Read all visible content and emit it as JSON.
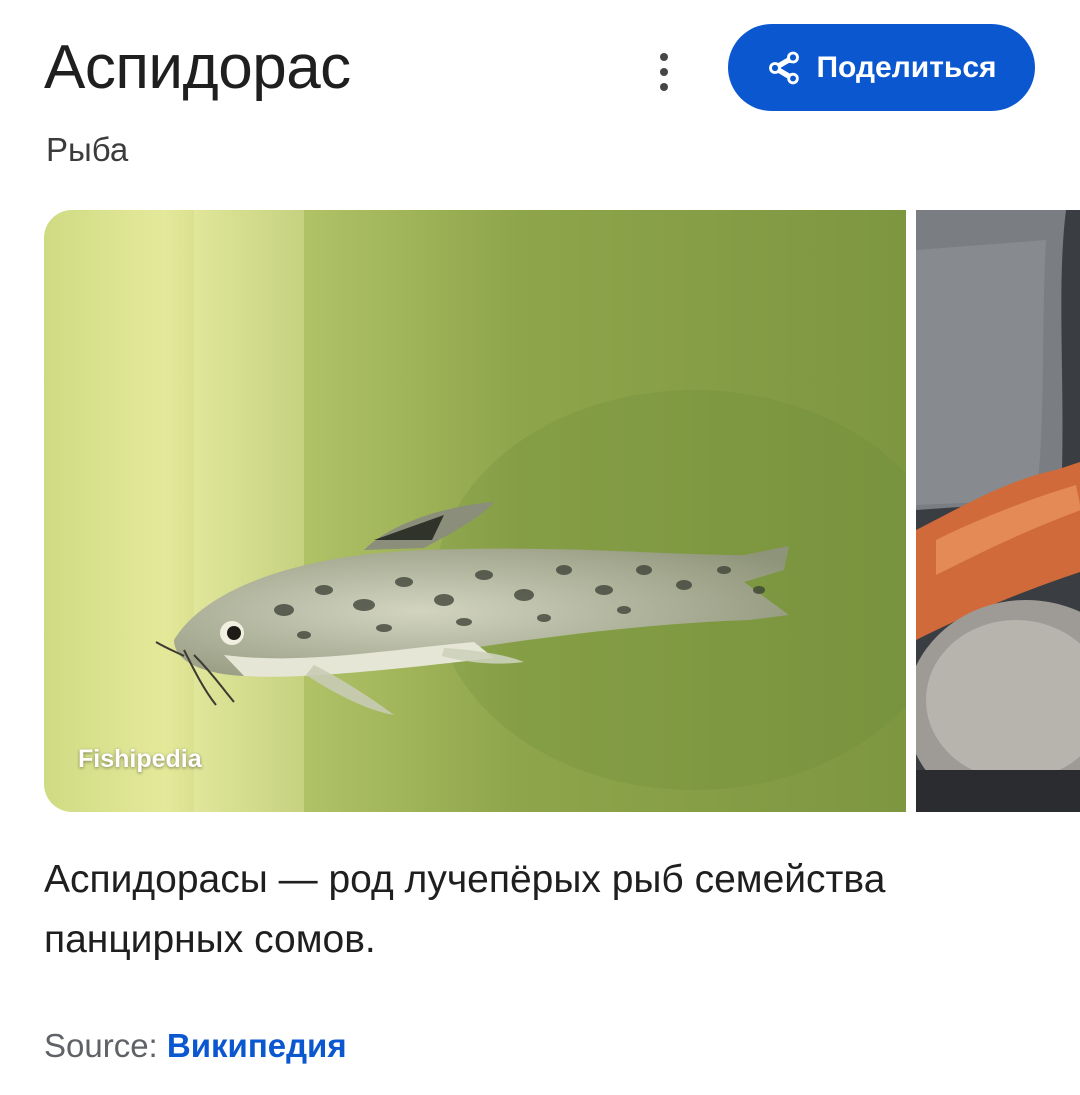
{
  "header": {
    "title": "Аспидорас",
    "subtitle": "Рыба",
    "share_label": "Поделиться",
    "share_icon": "share-icon",
    "more_icon": "more-vert-icon"
  },
  "images": [
    {
      "source": "Fishipedia"
    },
    {
      "source": ""
    }
  ],
  "description": "Аспидорасы — род лучепёрых рыб семейства панцирных сомов.",
  "source": {
    "prefix": "Source: ",
    "link": "Википедия"
  },
  "colors": {
    "accent": "#0b57d0",
    "text_primary": "#1f1f1f",
    "text_secondary": "#5f6368"
  }
}
